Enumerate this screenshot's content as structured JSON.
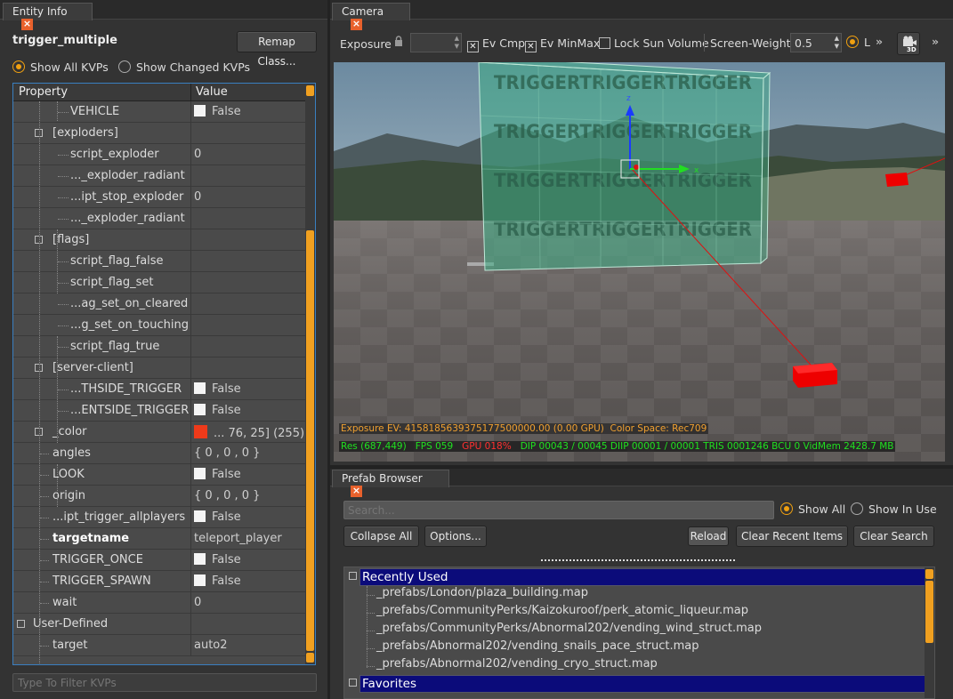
{
  "entity_panel": {
    "tab_title": "Entity Info",
    "classname": "trigger_multiple",
    "remap_button": "Remap Class...",
    "show_all_label": "Show All KVPs",
    "show_changed_label": "Show Changed KVPs",
    "col_property": "Property",
    "col_value": "Value",
    "filter_placeholder": "Type To Filter KVPs",
    "rows": [
      {
        "prop": "VEHICLE",
        "value": "False",
        "check": true
      },
      {
        "prop": "[exploders]",
        "value": ""
      },
      {
        "prop": "script_exploder",
        "value": "0"
      },
      {
        "prop": "..._exploder_radiant",
        "value": ""
      },
      {
        "prop": "...ipt_stop_exploder",
        "value": "0"
      },
      {
        "prop": "..._exploder_radiant",
        "value": ""
      },
      {
        "prop": "[flags]",
        "value": ""
      },
      {
        "prop": "script_flag_false",
        "value": ""
      },
      {
        "prop": "script_flag_set",
        "value": ""
      },
      {
        "prop": "...ag_set_on_cleared",
        "value": ""
      },
      {
        "prop": "...g_set_on_touching",
        "value": ""
      },
      {
        "prop": "script_flag_true",
        "value": ""
      },
      {
        "prop": "[server-client]",
        "value": ""
      },
      {
        "prop": "...THSIDE_TRIGGER",
        "value": "False",
        "check": true
      },
      {
        "prop": "...ENTSIDE_TRIGGER",
        "value": "False",
        "check": true
      },
      {
        "prop": "_color",
        "value": "... 76, 25] (255)",
        "swatch": "#ee3a1a"
      },
      {
        "prop": "angles",
        "value": "{ 0 , 0 , 0 }"
      },
      {
        "prop": "LOOK",
        "value": "False",
        "check": true
      },
      {
        "prop": "origin",
        "value": "{ 0 , 0 , 0 }"
      },
      {
        "prop": "...ipt_trigger_allplayers",
        "value": "False",
        "check": true
      },
      {
        "prop": "targetname",
        "value": "teleport_player",
        "bold": true
      },
      {
        "prop": "TRIGGER_ONCE",
        "value": "False",
        "check": true
      },
      {
        "prop": "TRIGGER_SPAWN",
        "value": "False",
        "check": true
      },
      {
        "prop": "wait",
        "value": "0"
      },
      {
        "prop": "User-Defined",
        "value": ""
      },
      {
        "prop": "target",
        "value": "auto2"
      }
    ]
  },
  "camera_panel": {
    "tab_title": "Camera",
    "exposure_label": "Exposure",
    "ev_cmp_label": "Ev Cmp",
    "ev_minmax_label": "Ev MinMax",
    "lock_sun_label": "Lock Sun Volume",
    "screen_weight_label": "Screen-Weight",
    "screen_weight_value": "0.5",
    "l_label": "L",
    "view_mode": "3D",
    "overflow_glyph": "»",
    "trigger_text": "TRIGGER",
    "axis_z": "z",
    "axis_x": "x",
    "stats_line1_exposure": "Exposure EV: 4158185639375177500000.00 (0.00 GPU)",
    "stats_line1_colorspace": "Color Space: Rec709",
    "stats_res": "Res (687,449)",
    "stats_fps": "FPS 059",
    "stats_gpu": "GPU 018%",
    "stats_rest": "DIP 00043 / 00045  DIIP 00001 / 00001  TRIS 0001246  BCU 0  VidMem 2428.7 MB"
  },
  "prefab_panel": {
    "tab_title": "Prefab Browser",
    "search_placeholder": "Search...",
    "show_all_label": "Show All",
    "show_in_use_label": "Show In Use",
    "collapse_all": "Collapse All",
    "options": "Options...",
    "reload": "Reload",
    "clear_recent": "Clear Recent Items",
    "clear_search": "Clear Search",
    "recent_header": "Recently Used",
    "favorites_header": "Favorites",
    "recent_items": [
      "_prefabs/London/plaza_building.map",
      "_prefabs/CommunityPerks/Kaizokuroof/perk_atomic_liqueur.map",
      "_prefabs/CommunityPerks/Abnormal202/vending_wind_struct.map",
      "_prefabs/Abnormal202/vending_snails_pace_struct.map",
      "_prefabs/Abnormal202/vending_cryo_struct.map"
    ]
  },
  "colors": {
    "accent": "#f0a010",
    "selection_blue": "#0b0b7a",
    "trigger_green": "#3fae86",
    "tab_close": "#e8612c"
  }
}
